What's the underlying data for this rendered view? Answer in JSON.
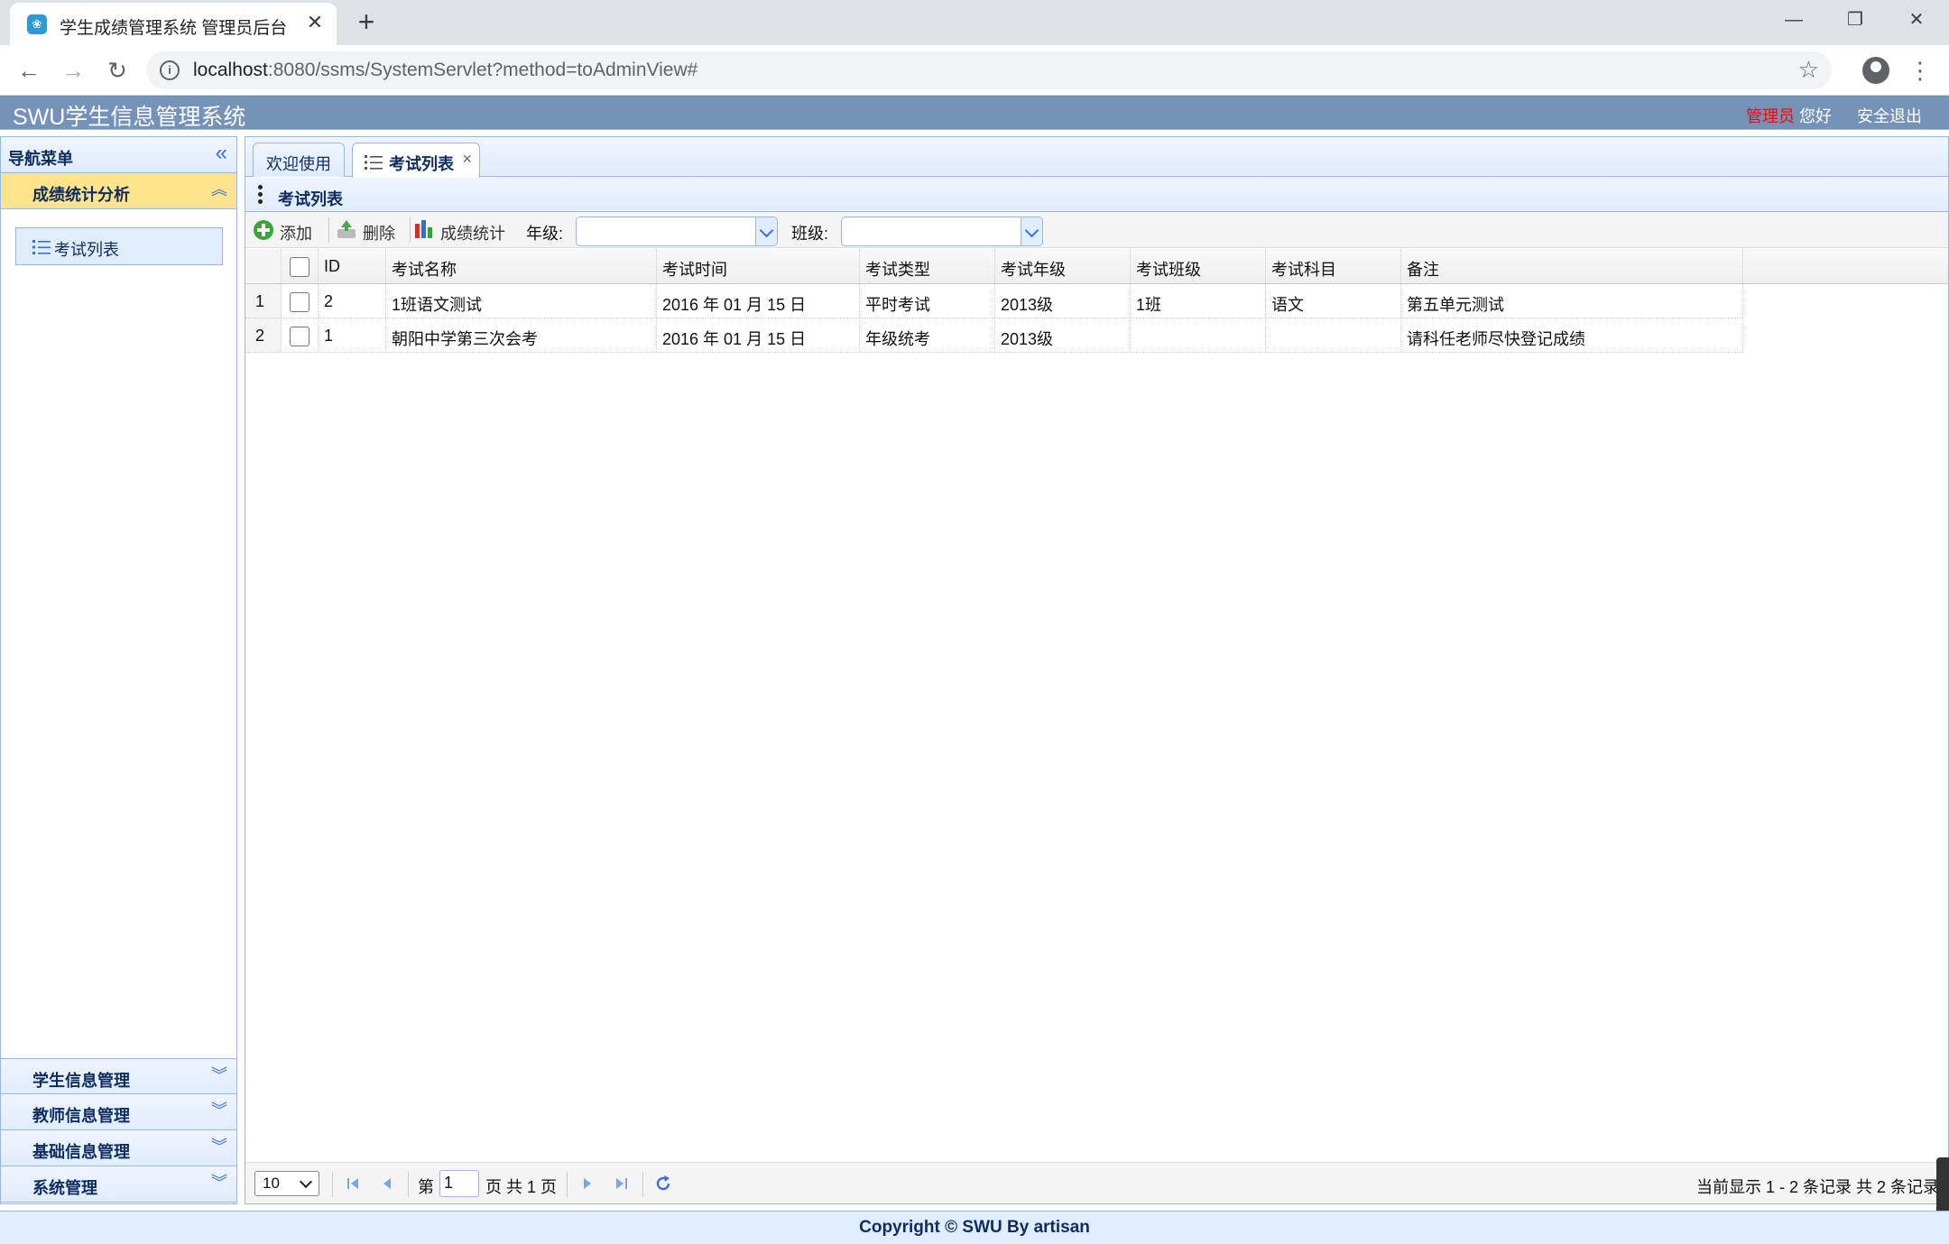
{
  "browser": {
    "tab_title": "学生成绩管理系统 管理员后台",
    "tab_close": "✕",
    "new_tab": "+",
    "url_host": "localhost",
    "url_rest": ":8080/ssms/SystemServlet?method=toAdminView#",
    "back": "←",
    "forward": "→",
    "reload": "↻",
    "star": "☆",
    "minimize": "—",
    "restore": "❐",
    "close": "✕",
    "menu": "⋮"
  },
  "header": {
    "title": "SWU学生信息管理系统",
    "role": "管理员",
    "greeting": "您好",
    "logout": "安全退出"
  },
  "west": {
    "title": "导航菜单",
    "collapse": "«",
    "sections": [
      {
        "title": "成绩统计分析",
        "icon": "︽"
      },
      {
        "title": "学生信息管理",
        "icon": "︾"
      },
      {
        "title": "教师信息管理",
        "icon": "︾"
      },
      {
        "title": "基础信息管理",
        "icon": "︾"
      },
      {
        "title": "系统管理",
        "icon": "︾"
      }
    ],
    "active_item": "考试列表"
  },
  "tabs": [
    {
      "label": "欢迎使用"
    },
    {
      "label": "考试列表",
      "close": "×"
    }
  ],
  "panel": {
    "title": "考试列表"
  },
  "toolbar": {
    "add": "添加",
    "delete": "删除",
    "stats": "成绩统计",
    "grade_label": "年级:",
    "class_label": "班级:",
    "grade_value": "",
    "class_value": ""
  },
  "grid": {
    "columns": [
      "ID",
      "考试名称",
      "考试时间",
      "考试类型",
      "考试年级",
      "考试班级",
      "考试科目",
      "备注"
    ],
    "rows": [
      {
        "num": "1",
        "id": "2",
        "name": "1班语文测试",
        "time": "2016 年 01 月 15 日",
        "type": "平时考试",
        "grade": "2013级",
        "class": "1班",
        "subject": "语文",
        "remark": "第五单元测试"
      },
      {
        "num": "2",
        "id": "1",
        "name": "朝阳中学第三次会考",
        "time": "2016 年 01 月 15 日",
        "type": "年级统考",
        "grade": "2013级",
        "class": "",
        "subject": "",
        "remark": "请科任老师尽快登记成绩"
      }
    ]
  },
  "pager": {
    "page_size": "10",
    "page_prefix": "第",
    "page_value": "1",
    "page_suffix": "页 共 1 页",
    "info": "当前显示 1 - 2 条记录 共 2 条记录"
  },
  "footer": {
    "text": "Copyright © SWU By artisan"
  }
}
